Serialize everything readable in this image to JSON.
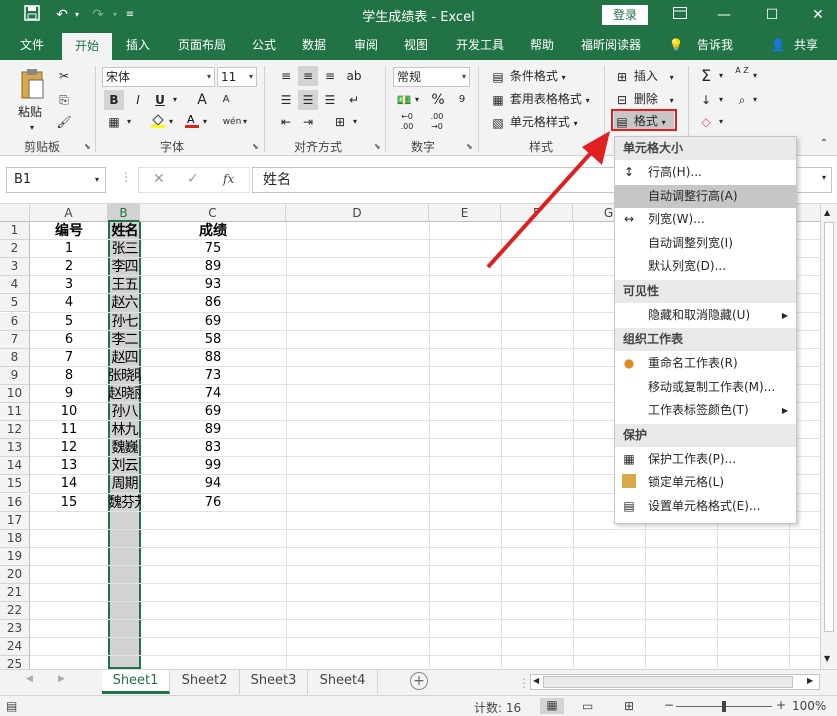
{
  "titlebar": {
    "title": "学生成绩表  -  Excel",
    "login": "登录",
    "save_icon": "save-icon",
    "undo_icon": "undo-icon",
    "redo_icon": "redo-icon"
  },
  "tabs": [
    "文件",
    "开始",
    "插入",
    "页面布局",
    "公式",
    "数据",
    "审阅",
    "视图",
    "开发工具",
    "帮助",
    "福昕阅读器",
    "告诉我",
    "共享"
  ],
  "ribbon": {
    "clipboard": {
      "paste": "粘贴",
      "label": "剪贴板"
    },
    "font": {
      "name": "宋体",
      "size": "11",
      "label": "字体",
      "bold": "B",
      "italic": "I",
      "underline": "U",
      "grow": "A",
      "shrink": "A",
      "wen": "wén"
    },
    "alignment": {
      "label": "对齐方式"
    },
    "number": {
      "format": "常规",
      "label": "数字",
      "percent": "%",
      "comma": "9",
      "inc": "←0 .00",
      "dec": ".00 →0"
    },
    "styles": {
      "conditional": "条件格式",
      "table": "套用表格格式",
      "cell": "单元格样式",
      "label": "样式"
    },
    "cells": {
      "insert": "插入",
      "delete": "删除",
      "format": "格式"
    },
    "editing": {
      "sum": "Σ",
      "sort": "A Z",
      "find": "⌕",
      "fill": "↓",
      "clear": "◇"
    }
  },
  "formula_bar": {
    "name_box": "B1",
    "fx": "fx",
    "value": "姓名"
  },
  "columns": [
    "A",
    "B",
    "C",
    "D",
    "E",
    "F",
    "G"
  ],
  "rows": [
    "1",
    "2",
    "3",
    "4",
    "5",
    "6",
    "7",
    "8",
    "9",
    "10",
    "11",
    "12",
    "13",
    "14",
    "15",
    "16",
    "17",
    "18",
    "19",
    "20",
    "21",
    "22",
    "23",
    "24",
    "25"
  ],
  "table": {
    "headers": [
      "编号",
      "姓名",
      "成绩"
    ],
    "data": [
      [
        "1",
        "张三",
        "75"
      ],
      [
        "2",
        "李四",
        "89"
      ],
      [
        "3",
        "王五",
        "93"
      ],
      [
        "4",
        "赵六",
        "86"
      ],
      [
        "5",
        "孙七",
        "69"
      ],
      [
        "6",
        "李二",
        "58"
      ],
      [
        "7",
        "赵四",
        "88"
      ],
      [
        "8",
        "张晓明",
        "73"
      ],
      [
        "9",
        "赵晓丽",
        "74"
      ],
      [
        "10",
        "孙八",
        "69"
      ],
      [
        "11",
        "林九",
        "89"
      ],
      [
        "12",
        "魏巍",
        "83"
      ],
      [
        "13",
        "刘云",
        "99"
      ],
      [
        "14",
        "周期",
        "94"
      ],
      [
        "15",
        "魏芬芳",
        "76"
      ]
    ]
  },
  "sheets": [
    "Sheet1",
    "Sheet2",
    "Sheet3",
    "Sheet4"
  ],
  "status": {
    "count": "计数: 16",
    "zoom": "100%"
  },
  "menu": {
    "sections": [
      {
        "title": "单元格大小",
        "items": [
          {
            "label": "行高(H)...",
            "icon": "row-height-icon"
          },
          {
            "label": "自动调整行高(A)",
            "icon": "",
            "highlighted": true
          },
          {
            "label": "列宽(W)...",
            "icon": "column-width-icon"
          },
          {
            "label": "自动调整列宽(I)",
            "icon": ""
          },
          {
            "label": "默认列宽(D)...",
            "icon": ""
          }
        ]
      },
      {
        "title": "可见性",
        "items": [
          {
            "label": "隐藏和取消隐藏(U)",
            "icon": "",
            "submenu": true
          }
        ]
      },
      {
        "title": "组织工作表",
        "items": [
          {
            "label": "重命名工作表(R)",
            "icon": "bullet-icon"
          },
          {
            "label": "移动或复制工作表(M)...",
            "icon": ""
          },
          {
            "label": "工作表标签颜色(T)",
            "icon": "",
            "submenu": true
          }
        ]
      },
      {
        "title": "保护",
        "items": [
          {
            "label": "保护工作表(P)...",
            "icon": "protect-sheet-icon"
          },
          {
            "label": "锁定单元格(L)",
            "icon": "lock-cell-icon"
          },
          {
            "label": "设置单元格格式(E)...",
            "icon": "format-cells-icon"
          }
        ]
      }
    ]
  },
  "colors": {
    "brand": "#217346",
    "highlight": "#e02020"
  }
}
